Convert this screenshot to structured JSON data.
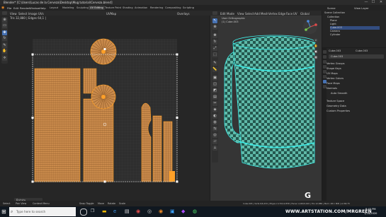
{
  "window": {
    "title": "Blender* [C:\\Users\\Lucas de la Cerveza\\Desktop\\Mug tutorial\\Cerveza.blend]",
    "minimize": "—",
    "maximize": "☐",
    "close": "✕"
  },
  "menu": {
    "items": [
      "File",
      "Edit",
      "Render",
      "Window",
      "Help"
    ],
    "workspaces": [
      "Layout",
      "Modeling",
      "Sculpting",
      "UV Editing",
      "Texture Paint",
      "Shading",
      "Animation",
      "Rendering",
      "Compositing",
      "Scripting"
    ],
    "active_workspace": "UV Editing",
    "scene": "Scene",
    "view_layer": "View Layer"
  },
  "uv_editor": {
    "header_items": [
      "View",
      "Select",
      "Image",
      "UVs"
    ],
    "image_name": "UVMap",
    "selection_info": "Tris 32,880 | Edges 64,1 |",
    "overlay": "Overlays"
  },
  "viewport": {
    "header_items": [
      "Edit Mode",
      "View",
      "Select",
      "Add",
      "Mesh",
      "Vertex",
      "Edge",
      "Face",
      "UV"
    ],
    "view_name": "User Orthographic",
    "object_label": "(1) Cube.003",
    "transform": "Global"
  },
  "outliner": {
    "title": "Scene Collection",
    "items": [
      {
        "label": "Scene Collection"
      },
      {
        "label": "Collection"
      },
      {
        "label": "Plane"
      },
      {
        "label": "Light"
      },
      {
        "label": "Cube.003"
      },
      {
        "label": "Camera"
      },
      {
        "label": "Cylinder"
      }
    ]
  },
  "properties": {
    "object_name": "Cube.003",
    "mesh_name": "Cube.003",
    "data_field": "Cube.003",
    "sections": [
      "Vertex Groups",
      "Shape Keys",
      "UV Maps",
      "Vertex Colors",
      "Face Maps",
      "Normals",
      "Auto Smooth",
      "Texture Space",
      "Geometry Data",
      "Custom Properties"
    ]
  },
  "redo_panel": "Rotate",
  "status": {
    "items": [
      "Select",
      "Pan View",
      "Context Menu",
      "Snap Toggle",
      "Move",
      "Rotate",
      "Scale"
    ],
    "stats": "Cube.003 | Verts 6/6,434 | Edges 2,170/12,858 | Faces 1,440/6,420 | Tris 12,880 | Mem: 48.1 MiB | v2.80.75"
  },
  "taskbar": {
    "search_placeholder": "Type here to search",
    "time": "8:40 PM",
    "date": "1/18/2020"
  },
  "watermark": "WWW.ARTSTATION.COM/MRGREEN",
  "logo": "G",
  "colors": {
    "accent": "#4772b3",
    "uv_wood": "#c98a4b",
    "uv_edge": "#ffa028",
    "mesh_cyan": "#3ff0ea"
  }
}
